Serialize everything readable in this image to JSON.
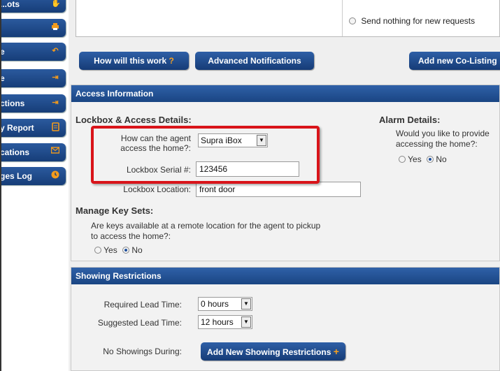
{
  "sidebar": {
    "items": [
      {
        "label": "...ots",
        "icon": "hand-icon"
      },
      {
        "label": "",
        "icon": "printer-icon"
      },
      {
        "label": "e",
        "icon": "return-icon"
      },
      {
        "label": "e",
        "icon": "arrow-right-icon"
      },
      {
        "label": "ctions",
        "icon": "arrow-right-icon"
      },
      {
        "label": "y Report",
        "icon": "document-icon"
      },
      {
        "label": "cations",
        "icon": "envelope-icon"
      },
      {
        "label": "ges Log",
        "icon": "clock-icon"
      }
    ]
  },
  "notifications": {
    "send_nothing_label": "Send nothing for new requests"
  },
  "toolbar": {
    "how_will_this_work": "How will this work",
    "how_icon": "?",
    "advanced_notifications": "Advanced Notifications",
    "add_co_listing": "Add new Co-Listing"
  },
  "access": {
    "header": "Access Information",
    "lockbox_title": "Lockbox & Access Details:",
    "how_access_label": "How can the agent access the home?:",
    "how_access_value": "Supra iBox",
    "serial_label": "Lockbox Serial #:",
    "serial_value": "123456",
    "location_label": "Lockbox Location:",
    "location_value": "front door",
    "alarm_title": "Alarm Details:",
    "alarm_question": "Would you like to provide accessing the home?:",
    "alarm_yes": "Yes",
    "alarm_no": "No",
    "alarm_selected": "No",
    "keysets_title": "Manage Key Sets:",
    "keysets_question": "Are keys available at a remote location for the agent to pickup to access the home?:",
    "keys_yes": "Yes",
    "keys_no": "No",
    "keys_selected": "No"
  },
  "showing": {
    "header": "Showing Restrictions",
    "required_label": "Required Lead Time:",
    "required_value": "0 hours",
    "suggested_label": "Suggested Lead Time:",
    "suggested_value": "12 hours",
    "no_showings_label": "No Showings During:",
    "add_button": "Add New Showing Restrictions",
    "add_icon": "+"
  },
  "colors": {
    "accent": "#1f4b8e",
    "highlight": "#d9141a",
    "icon_orange": "#f39b1c"
  }
}
